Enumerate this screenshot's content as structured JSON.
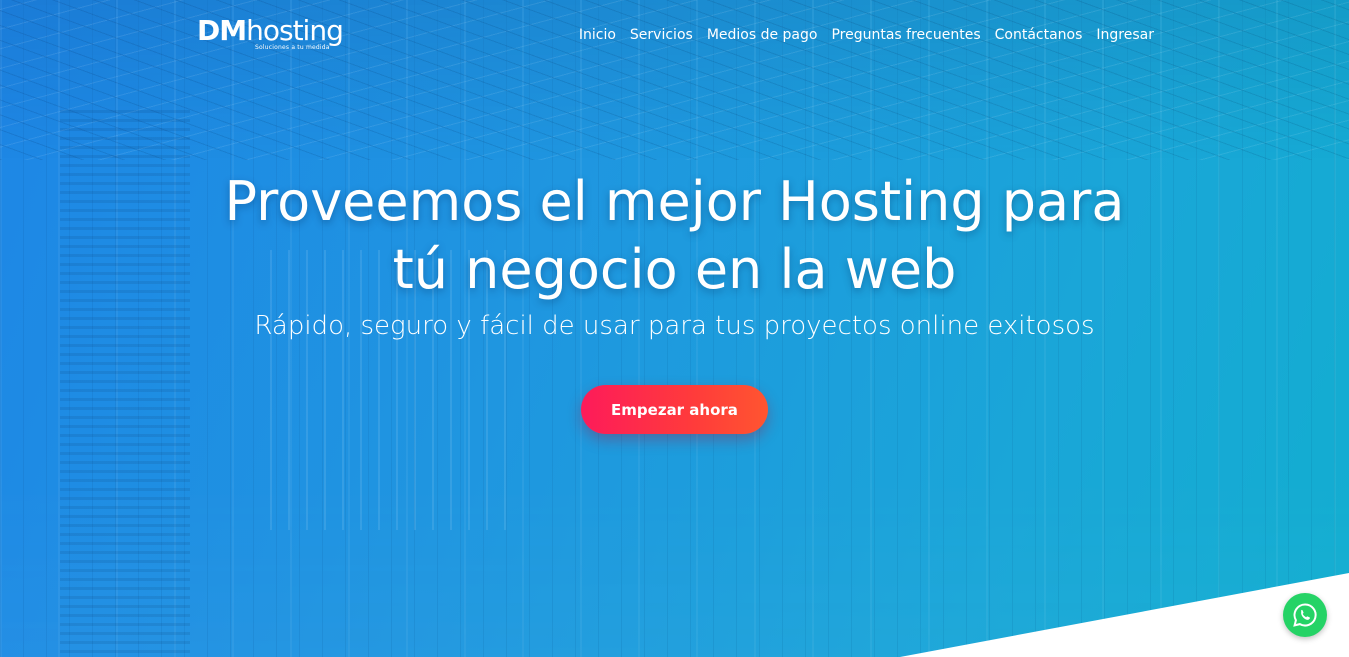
{
  "brand": {
    "logo_bold": "DM",
    "logo_light": "hosting",
    "tagline": "Soluciones a tu medida"
  },
  "nav": {
    "items": [
      {
        "label": "Inicio"
      },
      {
        "label": "Servicios"
      },
      {
        "label": "Medios de pago"
      },
      {
        "label": "Preguntas frecuentes"
      },
      {
        "label": "Contáctanos"
      },
      {
        "label": "Ingresar"
      }
    ]
  },
  "hero": {
    "title_line1": "Proveemos el mejor Hosting para",
    "title_line2": "tú negocio en la web",
    "subtitle": "Rápido, seguro y fácil de usar para tus proyectos online exitosos",
    "cta_label": "Empezar ahora"
  },
  "floating": {
    "icon": "whatsapp-icon"
  },
  "colors": {
    "hero_gradient_start": "#1e86e6",
    "hero_gradient_end": "#12aed0",
    "cta_start": "#fd1b5a",
    "cta_end": "#ff5530",
    "whatsapp": "#25d366",
    "text": "#ffffff"
  }
}
